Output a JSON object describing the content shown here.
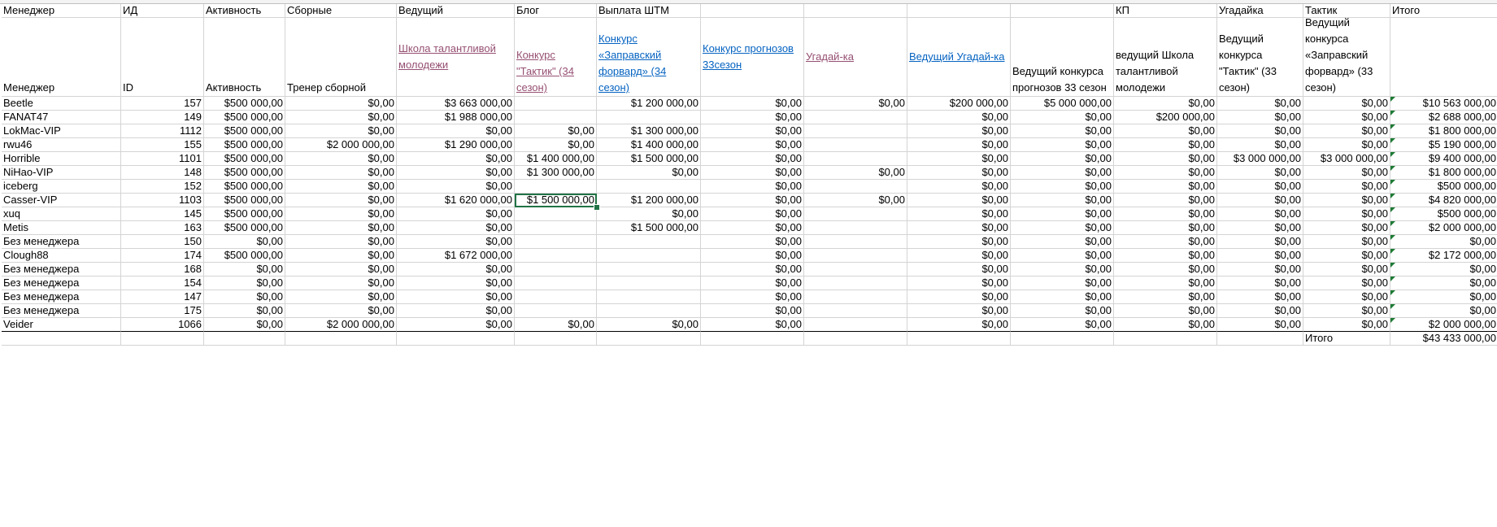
{
  "columns": [
    {
      "key": "manager",
      "w": 147,
      "hdr1": "Менеджер",
      "hdr2": "Менеджер",
      "align": "left"
    },
    {
      "key": "id",
      "w": 102,
      "hdr1": "ИД",
      "hdr2": "ID",
      "align": "right"
    },
    {
      "key": "activity",
      "w": 100,
      "hdr1": "Активность",
      "hdr2": "Активность",
      "align": "right"
    },
    {
      "key": "national",
      "w": 137,
      "hdr1": "Сборные",
      "hdr2": "Тренер сборной",
      "align": "right"
    },
    {
      "key": "host",
      "w": 145,
      "hdr1": "Ведущий",
      "hdr2": "Школа талантливой молодежи",
      "hdr2style": "link-purple",
      "hdr2pos": "mid",
      "align": "right"
    },
    {
      "key": "blog",
      "w": 101,
      "hdr1": "Блог",
      "hdr2": "Конкурс \"Тактик\" (34 сезон)",
      "hdr2style": "link-purple",
      "align": "right"
    },
    {
      "key": "stm",
      "w": 128,
      "hdr1": "Выплата ШТМ",
      "hdr2": "Конкурс «Заправский форвард» (34 сезон)",
      "hdr2style": "link-blue",
      "align": "right"
    },
    {
      "key": "forecast",
      "w": 127,
      "hdr1": "",
      "hdr2": "Конкурс прогнозов 33сезон",
      "hdr2style": "link-blue",
      "hdr2pos": "mid",
      "align": "right"
    },
    {
      "key": "guess",
      "w": 127,
      "hdr1": "",
      "hdr2": "Угадай-ка",
      "hdr2style": "link-purple",
      "hdr2pos": "mid",
      "align": "right"
    },
    {
      "key": "host_guess",
      "w": 127,
      "hdr1": "",
      "hdr2": "Ведущий Угадай-ка",
      "hdr2style": "link-blue",
      "hdr2pos": "mid",
      "align": "right"
    },
    {
      "key": "host_forecast",
      "w": 127,
      "hdr1": "",
      "hdr2": "Ведущий конкурса прогнозов 33 сезон",
      "align": "right"
    },
    {
      "key": "kp",
      "w": 127,
      "hdr1": "КП",
      "hdr2": "ведущий Школа талантливой молодежи",
      "align": "right"
    },
    {
      "key": "guesser",
      "w": 106,
      "hdr1": "Угадайка",
      "hdr2": "Ведущий конкурса \"Тактик\" (33 сезон)",
      "align": "right"
    },
    {
      "key": "tactic",
      "w": 107,
      "hdr1": "Тактик",
      "hdr2": "Ведущий конкурса «Заправский форвард» (33 сезон)",
      "align": "right"
    },
    {
      "key": "total",
      "w": 133,
      "hdr1": "Итого",
      "hdr2": "",
      "align": "right"
    }
  ],
  "rows": [
    {
      "manager": " Beetle",
      "id": "157",
      "activity": "$500 000,00",
      "national": "$0,00",
      "host": "$3 663 000,00",
      "blog": "",
      "stm": "$1 200 000,00",
      "forecast": "$0,00",
      "guess": "$0,00",
      "host_guess": "$200 000,00",
      "host_forecast": "$5 000 000,00",
      "kp": "$0,00",
      "guesser": "$0,00",
      "tactic": "$0,00",
      "total": "$10 563 000,00"
    },
    {
      "manager": "FANAT47",
      "id": "149",
      "activity": "$500 000,00",
      "national": "$0,00",
      "host": "$1 988 000,00",
      "blog": "",
      "stm": "",
      "forecast": "$0,00",
      "guess": "",
      "host_guess": "$0,00",
      "host_forecast": "$0,00",
      "kp": "$200 000,00",
      "guesser": "$0,00",
      "tactic": "$0,00",
      "total": "$2 688 000,00"
    },
    {
      "manager": " LokMac-VIP",
      "id": "1112",
      "activity": "$500 000,00",
      "national": "$0,00",
      "host": "$0,00",
      "blog": "$0,00",
      "stm": "$1 300 000,00",
      "forecast": "$0,00",
      "guess": "",
      "host_guess": "$0,00",
      "host_forecast": "$0,00",
      "kp": "$0,00",
      "guesser": "$0,00",
      "tactic": "$0,00",
      "total": "$1 800 000,00"
    },
    {
      "manager": " rwu46",
      "id": "155",
      "activity": "$500 000,00",
      "national": "$2 000 000,00",
      "host": "$1 290 000,00",
      "blog": "$0,00",
      "stm": "$1 400 000,00",
      "forecast": "$0,00",
      "guess": "",
      "host_guess": "$0,00",
      "host_forecast": "$0,00",
      "kp": "$0,00",
      "guesser": "$0,00",
      "tactic": "$0,00",
      "total": "$5 190 000,00"
    },
    {
      "manager": "Horrible",
      "id": "1101",
      "activity": "$500 000,00",
      "national": "$0,00",
      "host": "$0,00",
      "blog": "$1 400 000,00",
      "stm": "$1 500 000,00",
      "forecast": "$0,00",
      "guess": "",
      "host_guess": "$0,00",
      "host_forecast": "$0,00",
      "kp": "$0,00",
      "guesser": "$3 000 000,00",
      "tactic": "$3 000 000,00",
      "total": "$9 400 000,00"
    },
    {
      "manager": "NiHao-VIP",
      "id": "148",
      "activity": "$500 000,00",
      "national": "$0,00",
      "host": "$0,00",
      "blog": "$1 300 000,00",
      "stm": "$0,00",
      "forecast": "$0,00",
      "guess": "$0,00",
      "host_guess": "$0,00",
      "host_forecast": "$0,00",
      "kp": "$0,00",
      "guesser": "$0,00",
      "tactic": "$0,00",
      "total": "$1 800 000,00"
    },
    {
      "manager": " iceberg",
      "id": "152",
      "activity": "$500 000,00",
      "national": "$0,00",
      "host": "$0,00",
      "blog": "",
      "stm": "",
      "forecast": "$0,00",
      "guess": "",
      "host_guess": "$0,00",
      "host_forecast": "$0,00",
      "kp": "$0,00",
      "guesser": "$0,00",
      "tactic": "$0,00",
      "total": "$500 000,00"
    },
    {
      "manager": "Casser-VIP",
      "id": "1103",
      "activity": "$500 000,00",
      "national": "$0,00",
      "host": "$1 620 000,00",
      "blog": "$1 500 000,00",
      "stm": "$1 200 000,00",
      "forecast": "$0,00",
      "guess": "$0,00",
      "host_guess": "$0,00",
      "host_forecast": "$0,00",
      "kp": "$0,00",
      "guesser": "$0,00",
      "tactic": "$0,00",
      "total": "$4 820 000,00"
    },
    {
      "manager": " xuq",
      "id": "145",
      "activity": "$500 000,00",
      "national": "$0,00",
      "host": "$0,00",
      "blog": "",
      "stm": "$0,00",
      "forecast": "$0,00",
      "guess": "",
      "host_guess": "$0,00",
      "host_forecast": "$0,00",
      "kp": "$0,00",
      "guesser": "$0,00",
      "tactic": "$0,00",
      "total": "$500 000,00"
    },
    {
      "manager": "Metis",
      "id": "163",
      "activity": "$500 000,00",
      "national": "$0,00",
      "host": "$0,00",
      "blog": "",
      "stm": "$1 500 000,00",
      "forecast": "$0,00",
      "guess": "",
      "host_guess": "$0,00",
      "host_forecast": "$0,00",
      "kp": "$0,00",
      "guesser": "$0,00",
      "tactic": "$0,00",
      "total": "$2 000 000,00"
    },
    {
      "manager": "Без менеджера",
      "id": "150",
      "activity": "$0,00",
      "national": "$0,00",
      "host": "$0,00",
      "blog": "",
      "stm": "",
      "forecast": "$0,00",
      "guess": "",
      "host_guess": "$0,00",
      "host_forecast": "$0,00",
      "kp": "$0,00",
      "guesser": "$0,00",
      "tactic": "$0,00",
      "total": "$0,00"
    },
    {
      "manager": "Clough88",
      "id": "174",
      "activity": "$500 000,00",
      "national": "$0,00",
      "host": "$1 672 000,00",
      "blog": "",
      "stm": "",
      "forecast": "$0,00",
      "guess": "",
      "host_guess": "$0,00",
      "host_forecast": "$0,00",
      "kp": "$0,00",
      "guesser": "$0,00",
      "tactic": "$0,00",
      "total": "$2 172 000,00"
    },
    {
      "manager": "Без менеджера",
      "id": "168",
      "activity": "$0,00",
      "national": "$0,00",
      "host": "$0,00",
      "blog": "",
      "stm": "",
      "forecast": "$0,00",
      "guess": "",
      "host_guess": "$0,00",
      "host_forecast": "$0,00",
      "kp": "$0,00",
      "guesser": "$0,00",
      "tactic": "$0,00",
      "total": "$0,00"
    },
    {
      "manager": "Без менеджера",
      "id": "154",
      "activity": "$0,00",
      "national": "$0,00",
      "host": "$0,00",
      "blog": "",
      "stm": "",
      "forecast": "$0,00",
      "guess": "",
      "host_guess": "$0,00",
      "host_forecast": "$0,00",
      "kp": "$0,00",
      "guesser": "$0,00",
      "tactic": "$0,00",
      "total": "$0,00"
    },
    {
      "manager": "Без менеджера",
      "id": "147",
      "activity": "$0,00",
      "national": "$0,00",
      "host": "$0,00",
      "blog": "",
      "stm": "",
      "forecast": "$0,00",
      "guess": "",
      "host_guess": "$0,00",
      "host_forecast": "$0,00",
      "kp": "$0,00",
      "guesser": "$0,00",
      "tactic": "$0,00",
      "total": "$0,00"
    },
    {
      "manager": "Без менеджера",
      "id": "175",
      "activity": "$0,00",
      "national": "$0,00",
      "host": "$0,00",
      "blog": "",
      "stm": "",
      "forecast": "$0,00",
      "guess": "",
      "host_guess": "$0,00",
      "host_forecast": "$0,00",
      "kp": "$0,00",
      "guesser": "$0,00",
      "tactic": "$0,00",
      "total": "$0,00"
    },
    {
      "manager": "Veider",
      "id": "1066",
      "activity": "$0,00",
      "national": "$2 000 000,00",
      "host": "$0,00",
      "blog": "$0,00",
      "stm": "$0,00",
      "forecast": "$0,00",
      "guess": "",
      "host_guess": "$0,00",
      "host_forecast": "$0,00",
      "kp": "$0,00",
      "guesser": "$0,00",
      "tactic": "$0,00",
      "total": "$2 000 000,00"
    }
  ],
  "footer": {
    "label": "Итого",
    "value": "$43 433 000,00"
  },
  "selected_cell": {
    "row": 7,
    "col": "blog"
  },
  "colors": {
    "link_blue": "#0563c1",
    "link_purple": "#954f72",
    "selection": "#217346",
    "error_triangle": "#1e7b34"
  }
}
